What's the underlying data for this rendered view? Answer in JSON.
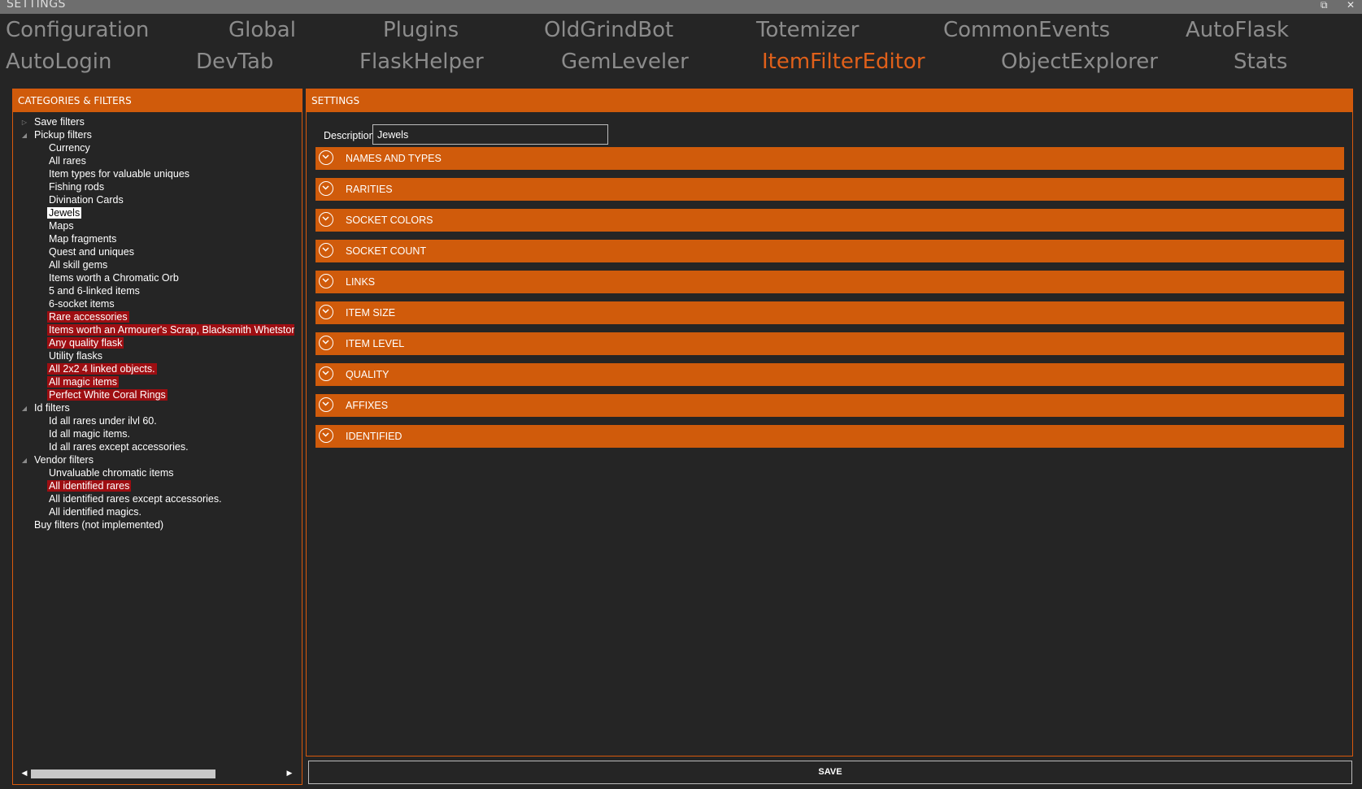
{
  "window": {
    "title": "SETTINGS",
    "restore_glyph": "⧉",
    "close_glyph": "✕"
  },
  "tabs": [
    {
      "label": "Configuration",
      "active": false
    },
    {
      "label": "Global",
      "active": false
    },
    {
      "label": "Plugins",
      "active": false
    },
    {
      "label": "OldGrindBot",
      "active": false
    },
    {
      "label": "Totemizer",
      "active": false
    },
    {
      "label": "CommonEvents",
      "active": false
    },
    {
      "label": "AutoFlask",
      "active": false
    },
    {
      "label": "AutoLogin",
      "active": false
    },
    {
      "label": "DevTab",
      "active": false
    },
    {
      "label": "FlaskHelper",
      "active": false
    },
    {
      "label": "GemLeveler",
      "active": false
    },
    {
      "label": "ItemFilterEditor",
      "active": true
    },
    {
      "label": "ObjectExplorer",
      "active": false
    },
    {
      "label": "Stats",
      "active": false
    }
  ],
  "colors": {
    "accent": "#d05b0b",
    "active_tab": "#e0601a",
    "inactive_tab": "#8c8c8c",
    "highlight": "#9e0e12",
    "background": "#252525"
  },
  "left_panel": {
    "title": "CATEGORIES & FILTERS",
    "tree": [
      {
        "label": "Save filters",
        "level": 0,
        "expander": "collapsed"
      },
      {
        "label": "Pickup filters",
        "level": 0,
        "expander": "expanded"
      },
      {
        "label": "Currency",
        "level": 1
      },
      {
        "label": "All rares",
        "level": 1
      },
      {
        "label": "Item types for valuable uniques",
        "level": 1
      },
      {
        "label": "Fishing rods",
        "level": 1
      },
      {
        "label": "Divination Cards",
        "level": 1
      },
      {
        "label": "Jewels",
        "level": 1,
        "selected": true
      },
      {
        "label": "Maps",
        "level": 1
      },
      {
        "label": "Map fragments",
        "level": 1
      },
      {
        "label": "Quest and uniques",
        "level": 1
      },
      {
        "label": "All skill gems",
        "level": 1
      },
      {
        "label": "Items worth a Chromatic Orb",
        "level": 1
      },
      {
        "label": "5 and 6-linked items",
        "level": 1
      },
      {
        "label": "6-socket items",
        "level": 1
      },
      {
        "label": "Rare accessories",
        "level": 1,
        "highlight": true
      },
      {
        "label": "Items worth an Armourer's Scrap, Blacksmith Whetstone, o",
        "level": 1,
        "highlight": true
      },
      {
        "label": "Any quality flask",
        "level": 1,
        "highlight": true
      },
      {
        "label": "Utility flasks",
        "level": 1
      },
      {
        "label": "All 2x2 4 linked objects.",
        "level": 1,
        "highlight": true
      },
      {
        "label": "All magic items",
        "level": 1,
        "highlight": true
      },
      {
        "label": "Perfect White Coral Rings",
        "level": 1,
        "highlight": true
      },
      {
        "label": "Id filters",
        "level": 0,
        "expander": "expanded"
      },
      {
        "label": "Id all rares under ilvl 60.",
        "level": 1
      },
      {
        "label": "Id all magic items.",
        "level": 1
      },
      {
        "label": "Id all rares except accessories.",
        "level": 1
      },
      {
        "label": "Vendor filters",
        "level": 0,
        "expander": "expanded"
      },
      {
        "label": "Unvaluable chromatic items",
        "level": 1
      },
      {
        "label": "All identified rares",
        "level": 1,
        "highlight": true
      },
      {
        "label": "All identified rares except accessories.",
        "level": 1
      },
      {
        "label": "All identified magics.",
        "level": 1
      },
      {
        "label": "Buy filters (not implemented)",
        "level": 0
      }
    ],
    "scroll_left_glyph": "◀",
    "scroll_right_glyph": "▶"
  },
  "right_panel": {
    "title": "SETTINGS",
    "description_label": "Description",
    "description_value": "Jewels",
    "sections": [
      "NAMES AND TYPES",
      "RARITIES",
      "SOCKET COLORS",
      "SOCKET COUNT",
      "LINKS",
      "ITEM SIZE",
      "ITEM LEVEL",
      "QUALITY",
      "AFFIXES",
      "IDENTIFIED"
    ],
    "save_label": "SAVE"
  }
}
